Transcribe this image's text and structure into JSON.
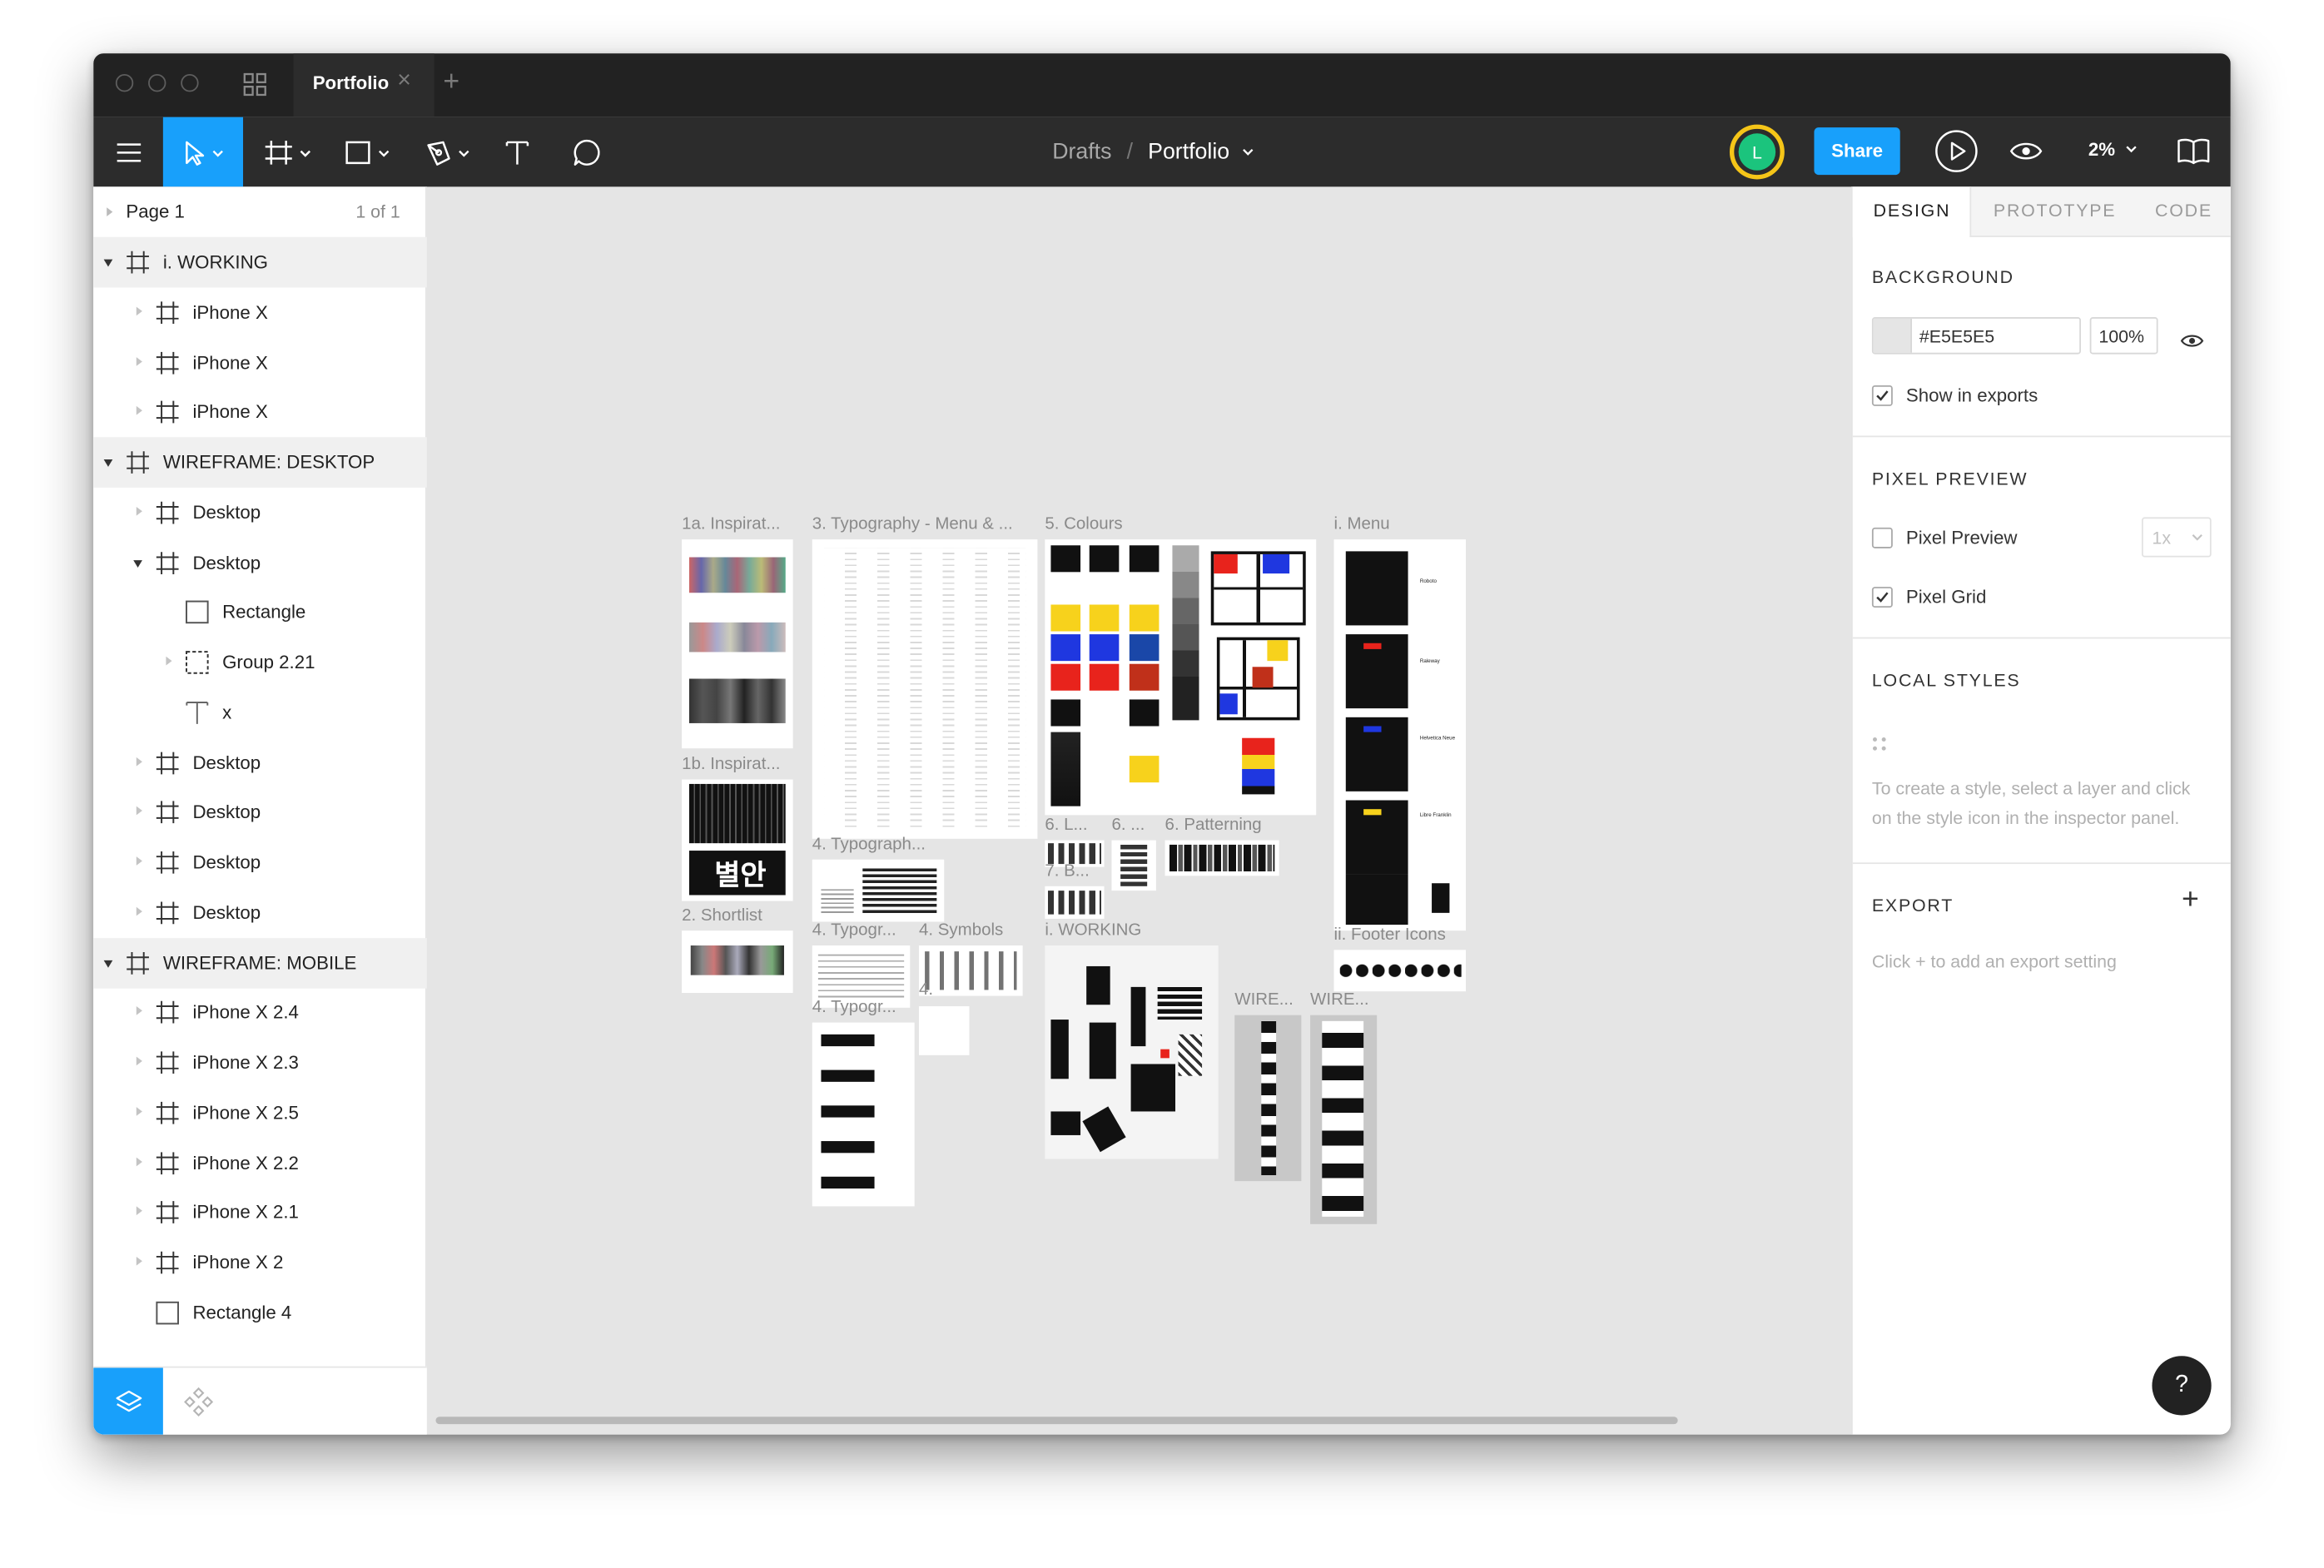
{
  "tabs": {
    "active": "Portfolio",
    "add_symbol": "+",
    "close_symbol": "×"
  },
  "toolbar": {
    "tools": [
      "move-tool",
      "frame-tool",
      "shape-tool",
      "pen-tool",
      "text-tool",
      "comment-tool"
    ],
    "breadcrumb_parent": "Drafts",
    "breadcrumb_separator": "/",
    "file_name": "Portfolio",
    "avatar_initial": "L",
    "avatar_ring_color": "#f5c518",
    "avatar_color": "#1bc47d",
    "share_label": "Share",
    "zoom": "2%",
    "accent_color": "#18a0fb"
  },
  "pages": {
    "current": "Page 1",
    "count": "1 of 1"
  },
  "layers": [
    {
      "label": "i. WORKING",
      "type": "frame",
      "level": 0,
      "group": true,
      "expanded": true
    },
    {
      "label": "iPhone X",
      "type": "frame",
      "level": 1
    },
    {
      "label": "iPhone X",
      "type": "frame",
      "level": 1
    },
    {
      "label": "iPhone X",
      "type": "frame",
      "level": 1
    },
    {
      "label": "WIREFRAME: DESKTOP",
      "type": "frame",
      "level": 0,
      "group": true,
      "expanded": true
    },
    {
      "label": "Desktop",
      "type": "frame",
      "level": 1
    },
    {
      "label": "Desktop",
      "type": "frame",
      "level": 1,
      "expanded": true
    },
    {
      "label": "Rectangle",
      "type": "rect",
      "level": 2
    },
    {
      "label": "Group 2.21",
      "type": "group",
      "level": 2
    },
    {
      "label": "x",
      "type": "text",
      "level": 2
    },
    {
      "label": "Desktop",
      "type": "frame",
      "level": 1
    },
    {
      "label": "Desktop",
      "type": "frame",
      "level": 1
    },
    {
      "label": "Desktop",
      "type": "frame",
      "level": 1
    },
    {
      "label": "Desktop",
      "type": "frame",
      "level": 1
    },
    {
      "label": "WIREFRAME: MOBILE",
      "type": "frame",
      "level": 0,
      "group": true,
      "expanded": true
    },
    {
      "label": "iPhone X 2.4",
      "type": "frame",
      "level": 1
    },
    {
      "label": "iPhone X 2.3",
      "type": "frame",
      "level": 1
    },
    {
      "label": "iPhone X 2.5",
      "type": "frame",
      "level": 1
    },
    {
      "label": "iPhone X 2.2",
      "type": "frame",
      "level": 1
    },
    {
      "label": "iPhone X 2.1",
      "type": "frame",
      "level": 1
    },
    {
      "label": "iPhone X 2",
      "type": "frame",
      "level": 1
    },
    {
      "label": "Rectangle 4",
      "type": "rect",
      "level": 1
    }
  ],
  "left_footer": {
    "tabs": [
      "layers-tab",
      "components-tab"
    ]
  },
  "inspector": {
    "tabs": [
      "DESIGN",
      "PROTOTYPE",
      "CODE"
    ],
    "active_tab": "DESIGN",
    "background": {
      "heading": "BACKGROUND",
      "color_hex": "#E5E5E5",
      "opacity": "100%",
      "show_in_exports_label": "Show in exports",
      "show_in_exports": true
    },
    "pixel_preview": {
      "heading": "PIXEL PREVIEW",
      "pixel_preview_label": "Pixel Preview",
      "pixel_preview": false,
      "scale": "1x",
      "pixel_grid_label": "Pixel Grid",
      "pixel_grid": true
    },
    "local_styles": {
      "heading": "LOCAL STYLES",
      "hint": "To create a style, select a layer and click on the style icon in the inspector panel."
    },
    "export": {
      "heading": "EXPORT",
      "add_symbol": "+",
      "hint": "Click + to add an export setting"
    },
    "help_symbol": "?"
  },
  "canvas": {
    "background": "#E5E5E5",
    "frame_labels": {
      "inspiration_a": "1a. Inspirat...",
      "inspiration_b": "1b. Inspirat...",
      "shortlist": "2. Shortlist",
      "typography_menu": "3. Typography - Menu & ...",
      "typography_b": "4. Typograph...",
      "typography_c": "4. Typogr...",
      "typography_d": "4. Typogr...",
      "symbols": "4. Symbols",
      "small_4": "4.",
      "colours": "5. Colours",
      "l6": "6. L...",
      "six": "6. ...",
      "patterning": "6. Patterning",
      "b7": "7. B...",
      "working": "i. WORKING",
      "menu": "i. Menu",
      "footer_icons": "ii. Footer Icons",
      "wire_a": "WIRE...",
      "wire_b": "WIRE..."
    },
    "korean_sample": "별안",
    "menu_font_labels": [
      "Roboto",
      "Raleway",
      "Helvetica Neue",
      "Libre Franklin"
    ],
    "palette": [
      "#1a1a1a",
      "#f7d21c",
      "#1f37e0",
      "#e8231c",
      "#ffffff",
      "#8c8c8c"
    ]
  }
}
